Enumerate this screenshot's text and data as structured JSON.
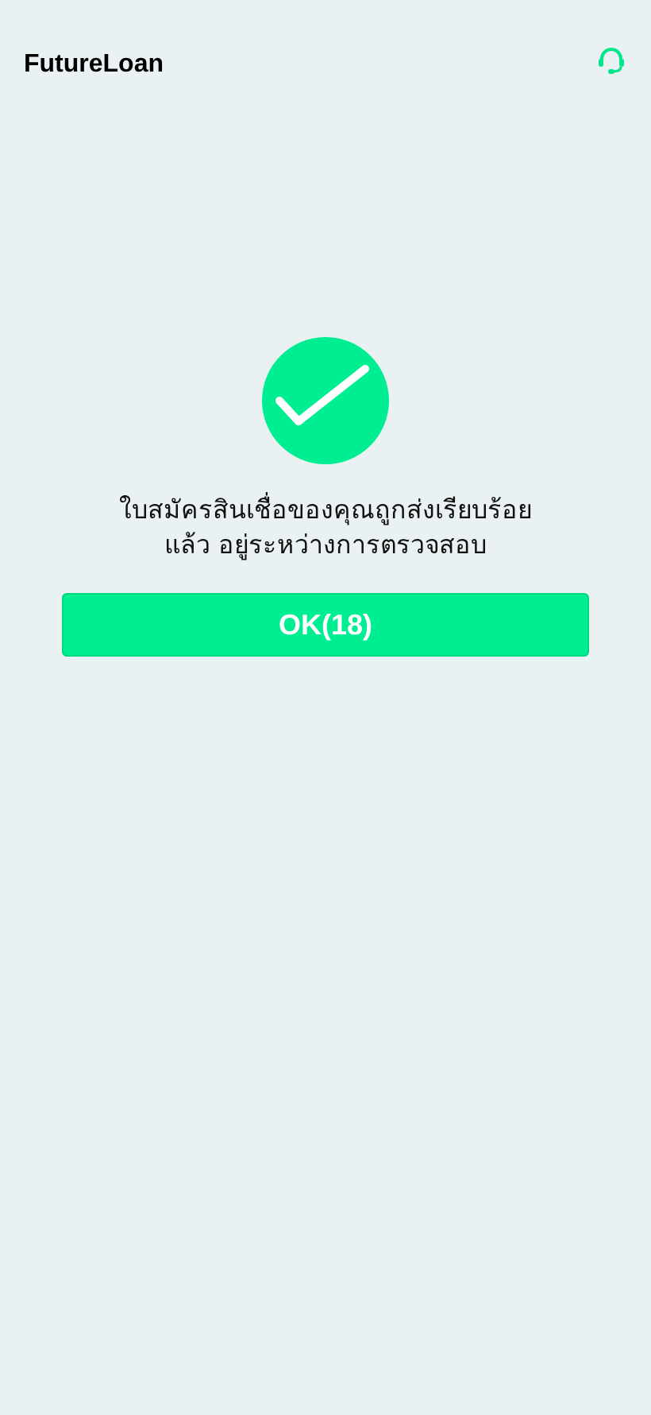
{
  "header": {
    "title": "FutureLoan"
  },
  "message_lines": [
    "ใบสมัครสินเชื่อของคุณถูกส่งเรียบร้อย",
    "แล้ว อยู่ระหว่างการตรวจสอบ"
  ],
  "button": {
    "label": "OK(18)"
  }
}
